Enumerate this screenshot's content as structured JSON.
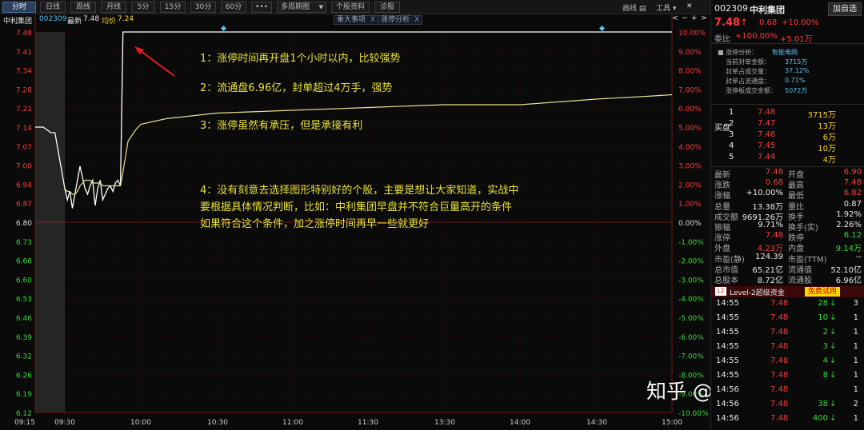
{
  "toolbar": {
    "periods": [
      "分时",
      "日线",
      "周线",
      "月线",
      "5分",
      "15分",
      "30分",
      "60分"
    ],
    "more": "•••",
    "multi": "多周期图",
    "report": "个股资料",
    "diag": "诊股",
    "drawline": "画线",
    "tools": "工具",
    "addfav": "加自选"
  },
  "info": {
    "name": "中利集团",
    "code": "002309",
    "latest_label": "最新",
    "latest": "7.48",
    "avg_label": "均价",
    "avg": "7.24",
    "tag1": "重大事项",
    "tag2": "涨停分析",
    "tag_close": "X"
  },
  "axis": {
    "price_ticks": [
      "7.48",
      "7.41",
      "7.34",
      "7.28",
      "7.21",
      "7.14",
      "7.07",
      "7.00",
      "6.94",
      "6.87",
      "6.80",
      "6.73",
      "6.66",
      "6.60",
      "6.53",
      "6.46",
      "6.39",
      "6.32",
      "6.26",
      "6.19",
      "6.12"
    ],
    "pct_ticks": [
      "10.00%",
      "9.00%",
      "8.00%",
      "7.00%",
      "6.00%",
      "5.00%",
      "4.00%",
      "3.00%",
      "2.00%",
      "1.00%",
      "0.00%",
      "-1.00%",
      "-2.00%",
      "-3.00%",
      "-4.00%",
      "-5.00%",
      "-6.00%",
      "-7.00%",
      "-8.00%",
      "-9.00%",
      "-10.00%"
    ],
    "time_ticks": [
      "09:15",
      "09:30",
      "10:00",
      "10:30",
      "11:00",
      "11:30",
      "13:30",
      "14:00",
      "14:30",
      "15:00"
    ]
  },
  "chart_data": {
    "type": "line",
    "ylim": [
      6.12,
      7.48
    ],
    "x": [
      "09:15",
      "09:19",
      "09:23",
      "09:25",
      "09:30",
      "09:31",
      "09:32",
      "09:33",
      "09:34",
      "09:35",
      "09:36",
      "09:37",
      "09:38",
      "09:39",
      "09:40",
      "09:41",
      "09:42",
      "09:43",
      "09:44",
      "09:45",
      "09:46",
      "09:47",
      "09:48",
      "09:49",
      "09:50",
      "09:51",
      "09:52",
      "09:53",
      "09:55",
      "09:58",
      "10:00",
      "10:10",
      "10:30",
      "11:00",
      "11:30",
      "13:30",
      "14:00",
      "14:30",
      "14:50"
    ],
    "series": [
      {
        "values": [
          7.14,
          7.14,
          7.12,
          7.12,
          6.92,
          6.88,
          6.91,
          6.85,
          6.9,
          6.95,
          7.0,
          6.96,
          6.92,
          6.9,
          6.93,
          6.95,
          6.86,
          6.92,
          6.95,
          6.88,
          6.9,
          6.92,
          6.93,
          6.91,
          6.94,
          6.95,
          6.93,
          7.48,
          7.48,
          7.48,
          7.48,
          7.48,
          7.48,
          7.48,
          7.48,
          7.48,
          7.48,
          7.48,
          7.48
        ]
      },
      {
        "values": [
          null,
          null,
          null,
          null,
          6.92,
          6.91,
          6.91,
          6.9,
          6.9,
          6.91,
          6.93,
          6.94,
          6.95,
          6.95,
          6.95,
          6.94,
          6.94,
          6.94,
          6.94,
          6.93,
          6.93,
          6.93,
          6.93,
          6.93,
          6.93,
          6.93,
          6.93,
          6.98,
          7.09,
          7.13,
          7.15,
          7.17,
          7.19,
          7.2,
          7.21,
          7.22,
          7.22,
          7.24,
          7.25
        ]
      }
    ]
  },
  "annotations": [
    "1：涨停时间再开盘1个小时以内，比较强势",
    "2：流通盘6.96亿，封单超过4万手，强势",
    "3：涨停虽然有承压，但是承接有利",
    "4：没有刻意去选择图形特别好的个股，主要是想让大家知道，实战中",
    "要根据具体情况判断，比如：中利集团早盘并不符合巨量高开的条件",
    "如果符合这个条件，加之涨停时间再早一些就更好"
  ],
  "watermark": "知乎 @steady杉塘",
  "panel": {
    "code": "002309",
    "name": "中利集团",
    "price": "7.48",
    "arrow": "↑",
    "chg": "0.68",
    "chgpct": "+10.00%",
    "wb_label": "委比",
    "wb": "+100.00%",
    "wb2": "+5.01万",
    "zt_title_label": "涨停分析：",
    "zt_title": "智能电网",
    "zt_rows": [
      [
        "当前封单金额：",
        "3715万"
      ],
      [
        "封单占成交量：",
        "37.12%"
      ],
      [
        "封单占流通盘：",
        "0.71%"
      ],
      [
        "涨停板成交金额：",
        "5072万"
      ]
    ],
    "buy_label": "买盘",
    "bids": [
      [
        "1",
        "7.48",
        "3715万"
      ],
      [
        "2",
        "7.47",
        "13万"
      ],
      [
        "3",
        "7.46",
        "6万"
      ],
      [
        "4",
        "7.45",
        "10万"
      ],
      [
        "5",
        "7.44",
        "4万"
      ]
    ],
    "stats": [
      [
        "最新",
        "7.48",
        "开盘",
        "6.90"
      ],
      [
        "涨跌",
        "0.68",
        "最高",
        "7.48"
      ],
      [
        "涨幅",
        "+10.00%",
        "最低",
        "6.82"
      ],
      [
        "总量",
        "13.38万",
        "量比",
        "0.87"
      ],
      [
        "成交额",
        "9691.26万",
        "换手",
        "1.92%"
      ],
      [
        "振幅",
        "9.71%",
        "换手(实)",
        "2.26%"
      ],
      [
        "涨停",
        "7.48",
        "跌停",
        "6.12"
      ],
      [
        "外盘",
        "4.23万",
        "内盘",
        "9.14万"
      ],
      [
        "市盈(静)",
        "124.39",
        "市盈(TTM)",
        "--"
      ],
      [
        "总市值",
        "65.21亿",
        "流通值",
        "52.10亿"
      ],
      [
        "总股本",
        "8.72亿",
        "流通股",
        "6.96亿"
      ]
    ],
    "l2_badge": "L2",
    "l2_label": "Level-2超级资金",
    "l2_btn": "免费试用",
    "ticks": [
      [
        "14:55",
        "7.48",
        "28",
        "↓",
        "3"
      ],
      [
        "14:55",
        "7.48",
        "10",
        "↓",
        "1"
      ],
      [
        "14:55",
        "7.48",
        "2",
        "↓",
        "1"
      ],
      [
        "14:55",
        "7.48",
        "3",
        "↓",
        "1"
      ],
      [
        "14:55",
        "7.48",
        "4",
        "↓",
        "1"
      ],
      [
        "14:55",
        "7.48",
        "8",
        "↓",
        "1"
      ],
      [
        "14:56",
        "7.48",
        "",
        "",
        "1"
      ],
      [
        "14:56",
        "7.48",
        "38",
        "↓",
        "2"
      ],
      [
        "14:56",
        "7.48",
        "400",
        "↓",
        "1"
      ]
    ]
  },
  "colors": {
    "up": "#ff3a3a",
    "down": "#33dd33",
    "price_line": "#ffffff",
    "avg_line": "#e6e08c",
    "grid": "#3a0f0f"
  }
}
